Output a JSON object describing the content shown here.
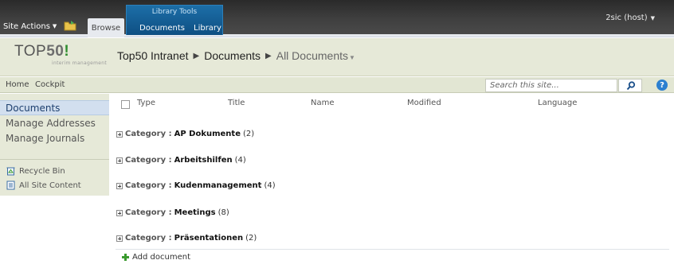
{
  "ribbon": {
    "site_actions": "Site Actions",
    "browse_tab": "Browse",
    "tools_group": "Library Tools",
    "tabs": [
      {
        "label": "Documents"
      },
      {
        "label": "Library"
      }
    ],
    "user": "2sic (host)"
  },
  "header": {
    "logo_text": "TOP",
    "logo_number": "50",
    "logo_bang": "!",
    "logo_tagline": "interim management",
    "breadcrumb": {
      "site": "Top50 Intranet",
      "library": "Documents",
      "view": "All Documents"
    }
  },
  "topnav": {
    "links": [
      {
        "label": "Home"
      },
      {
        "label": "Cockpit"
      }
    ],
    "search_placeholder": "Search this site...",
    "help": "?"
  },
  "quicklaunch": {
    "items": [
      {
        "label": "Documents",
        "selected": true
      },
      {
        "label": "Manage Addresses"
      },
      {
        "label": "Manage Journals"
      }
    ],
    "recycle_bin": "Recycle Bin",
    "all_site_content": "All Site Content"
  },
  "list": {
    "columns": [
      {
        "label": "Type"
      },
      {
        "label": "Title"
      },
      {
        "label": "Name"
      },
      {
        "label": "Modified"
      },
      {
        "label": "Language"
      }
    ],
    "group_prefix": "Category :",
    "groups": [
      {
        "name": "AP Dokumente",
        "count": "(2)"
      },
      {
        "name": "Arbeitshilfen",
        "count": "(4)"
      },
      {
        "name": "Kudenmanagement",
        "count": "(4)"
      },
      {
        "name": "Meetings",
        "count": "(8)"
      },
      {
        "name": "Präsentationen",
        "count": "(2)"
      }
    ],
    "add_document": "Add document"
  },
  "colors": {
    "ribbon_dark": "#3a3a3a",
    "tools_blue": "#1c6ea7",
    "header_bg": "#e6e9d8",
    "selected_bg": "#d2dfef",
    "help_blue": "#2b7fd0",
    "add_green": "#3a9a2e",
    "logo_green": "#2f8d2f"
  },
  "icons": {
    "folder": "folder-icon",
    "search": "search-icon",
    "help": "help-icon",
    "recycle_bin": "recycle-bin-icon",
    "all_site_content": "site-content-icon",
    "expand": "expand-plus-icon",
    "add": "add-plus-icon"
  }
}
